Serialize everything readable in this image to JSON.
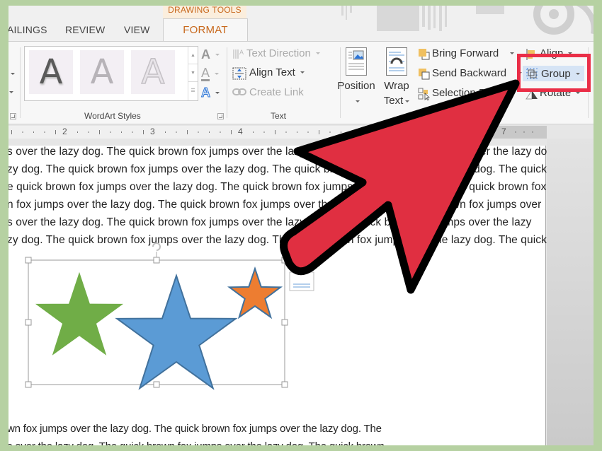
{
  "ribbon": {
    "context_tab_label": "DRAWING TOOLS",
    "tabs": [
      {
        "label": "AILINGS",
        "active": false
      },
      {
        "label": "REVIEW",
        "active": false
      },
      {
        "label": "VIEW",
        "active": false
      },
      {
        "label": "FORMAT",
        "active": true
      }
    ],
    "groups": {
      "wordart": {
        "label": "WordArt Styles",
        "gallery_samples": [
          "A",
          "A",
          "A"
        ],
        "text_fill_glyph": "A",
        "text_outline_glyph": "A",
        "text_effects_glyph": "A"
      },
      "text": {
        "label": "Text",
        "text_direction": "Text Direction",
        "align_text": "Align Text",
        "create_link": "Create Link"
      },
      "arrange": {
        "position": "Position",
        "wrap_text_line1": "Wrap",
        "wrap_text_line2": "Text",
        "bring_forward": "Bring Forward",
        "send_backward": "Send Backward",
        "selection_pane": "Selection Pane",
        "align": "Align",
        "group": "Group",
        "rotate": "Rotate"
      }
    }
  },
  "ruler": {
    "labels": [
      "2",
      "3",
      "4",
      "7"
    ]
  },
  "document": {
    "lines_top": [
      "s over the lazy dog. The quick brown fox jumps over the lazy dog. The quick brown fox jumps over the lazy dog.",
      "zy dog. The quick brown fox jumps over the lazy dog. The quick brown fox jumps over the lazy dog. The quick",
      "e quick brown fox jumps over the lazy dog. The quick brown fox jumps over the lazy dog. The quick brown fox",
      "n fox jumps over the lazy dog.  The quick brown fox jumps over the lazy dog.  The quick brown fox jumps over",
      "s over the lazy dog. The quick brown fox jumps over the lazy dog. The quick brown fox jumps over the lazy",
      "zy dog. The quick brown fox jumps over the lazy dog. The quick brown fox jumps over the lazy dog. The quick"
    ],
    "lines_bottom": [
      "wn fox jumps over the lazy dog.  The quick brown fox jumps over the lazy dog.  The",
      "s over the lazy dog. The quick brown fox jumps over the lazy dog. The quick brown"
    ],
    "shapes": [
      {
        "type": "star",
        "color": "#70ad47",
        "stroke": "#70ad47",
        "label": "green star"
      },
      {
        "type": "star",
        "color": "#5b9bd5",
        "stroke": "#41719c",
        "label": "blue star"
      },
      {
        "type": "star",
        "color": "#ed7d31",
        "stroke": "#41719c",
        "label": "orange star"
      }
    ]
  },
  "annotation": {
    "arrow_color": "#e02f41",
    "highlight_color": "#ea2e47",
    "highlight_target": "Group"
  }
}
